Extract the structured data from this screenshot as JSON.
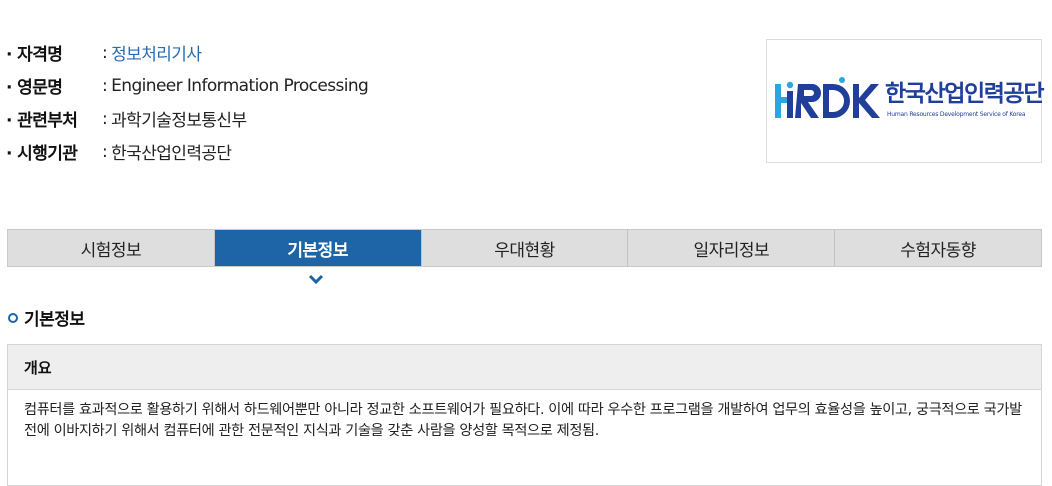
{
  "info": {
    "rows": [
      {
        "label": "· 자격명",
        "sep": ":",
        "value": "정보처리기사"
      },
      {
        "label": "· 영문명",
        "sep": ":",
        "value": "Engineer Information Processing"
      },
      {
        "label": "· 관련부처",
        "sep": ":",
        "value": "과학기술정보통신부"
      },
      {
        "label": "· 시행기관",
        "sep": ":",
        "value": "한국산업인력공단"
      }
    ]
  },
  "logo": {
    "mark": "HRDK",
    "korean": "한국산업인력공단",
    "english": "Human Resources Development Service of Korea",
    "brand_color": "#1f3f9a",
    "accent_color": "#2ba7e0"
  },
  "tabs": [
    {
      "label": "시험정보",
      "active": false
    },
    {
      "label": "기본정보",
      "active": true
    },
    {
      "label": "우대현황",
      "active": false
    },
    {
      "label": "일자리정보",
      "active": false
    },
    {
      "label": "수험자동향",
      "active": false
    }
  ],
  "active_tab_color": "#1d65a6",
  "section": {
    "title": "기본정보",
    "icon": "ring-bullet-icon"
  },
  "overview": {
    "heading": "개요",
    "text": "컴퓨터를 효과적으로 활용하기 위해서 하드웨어뿐만 아니라 정교한 소프트웨어가 필요하다. 이에 따라 우수한 프로그램을 개발하여 업무의 효율성을 높이고, 궁극적으로 국가발전에 이바지하기 위해서 컴퓨터에 관한 전문적인 지식과 기술을 갖춘 사람을 양성할 목적으로 제정됨."
  }
}
